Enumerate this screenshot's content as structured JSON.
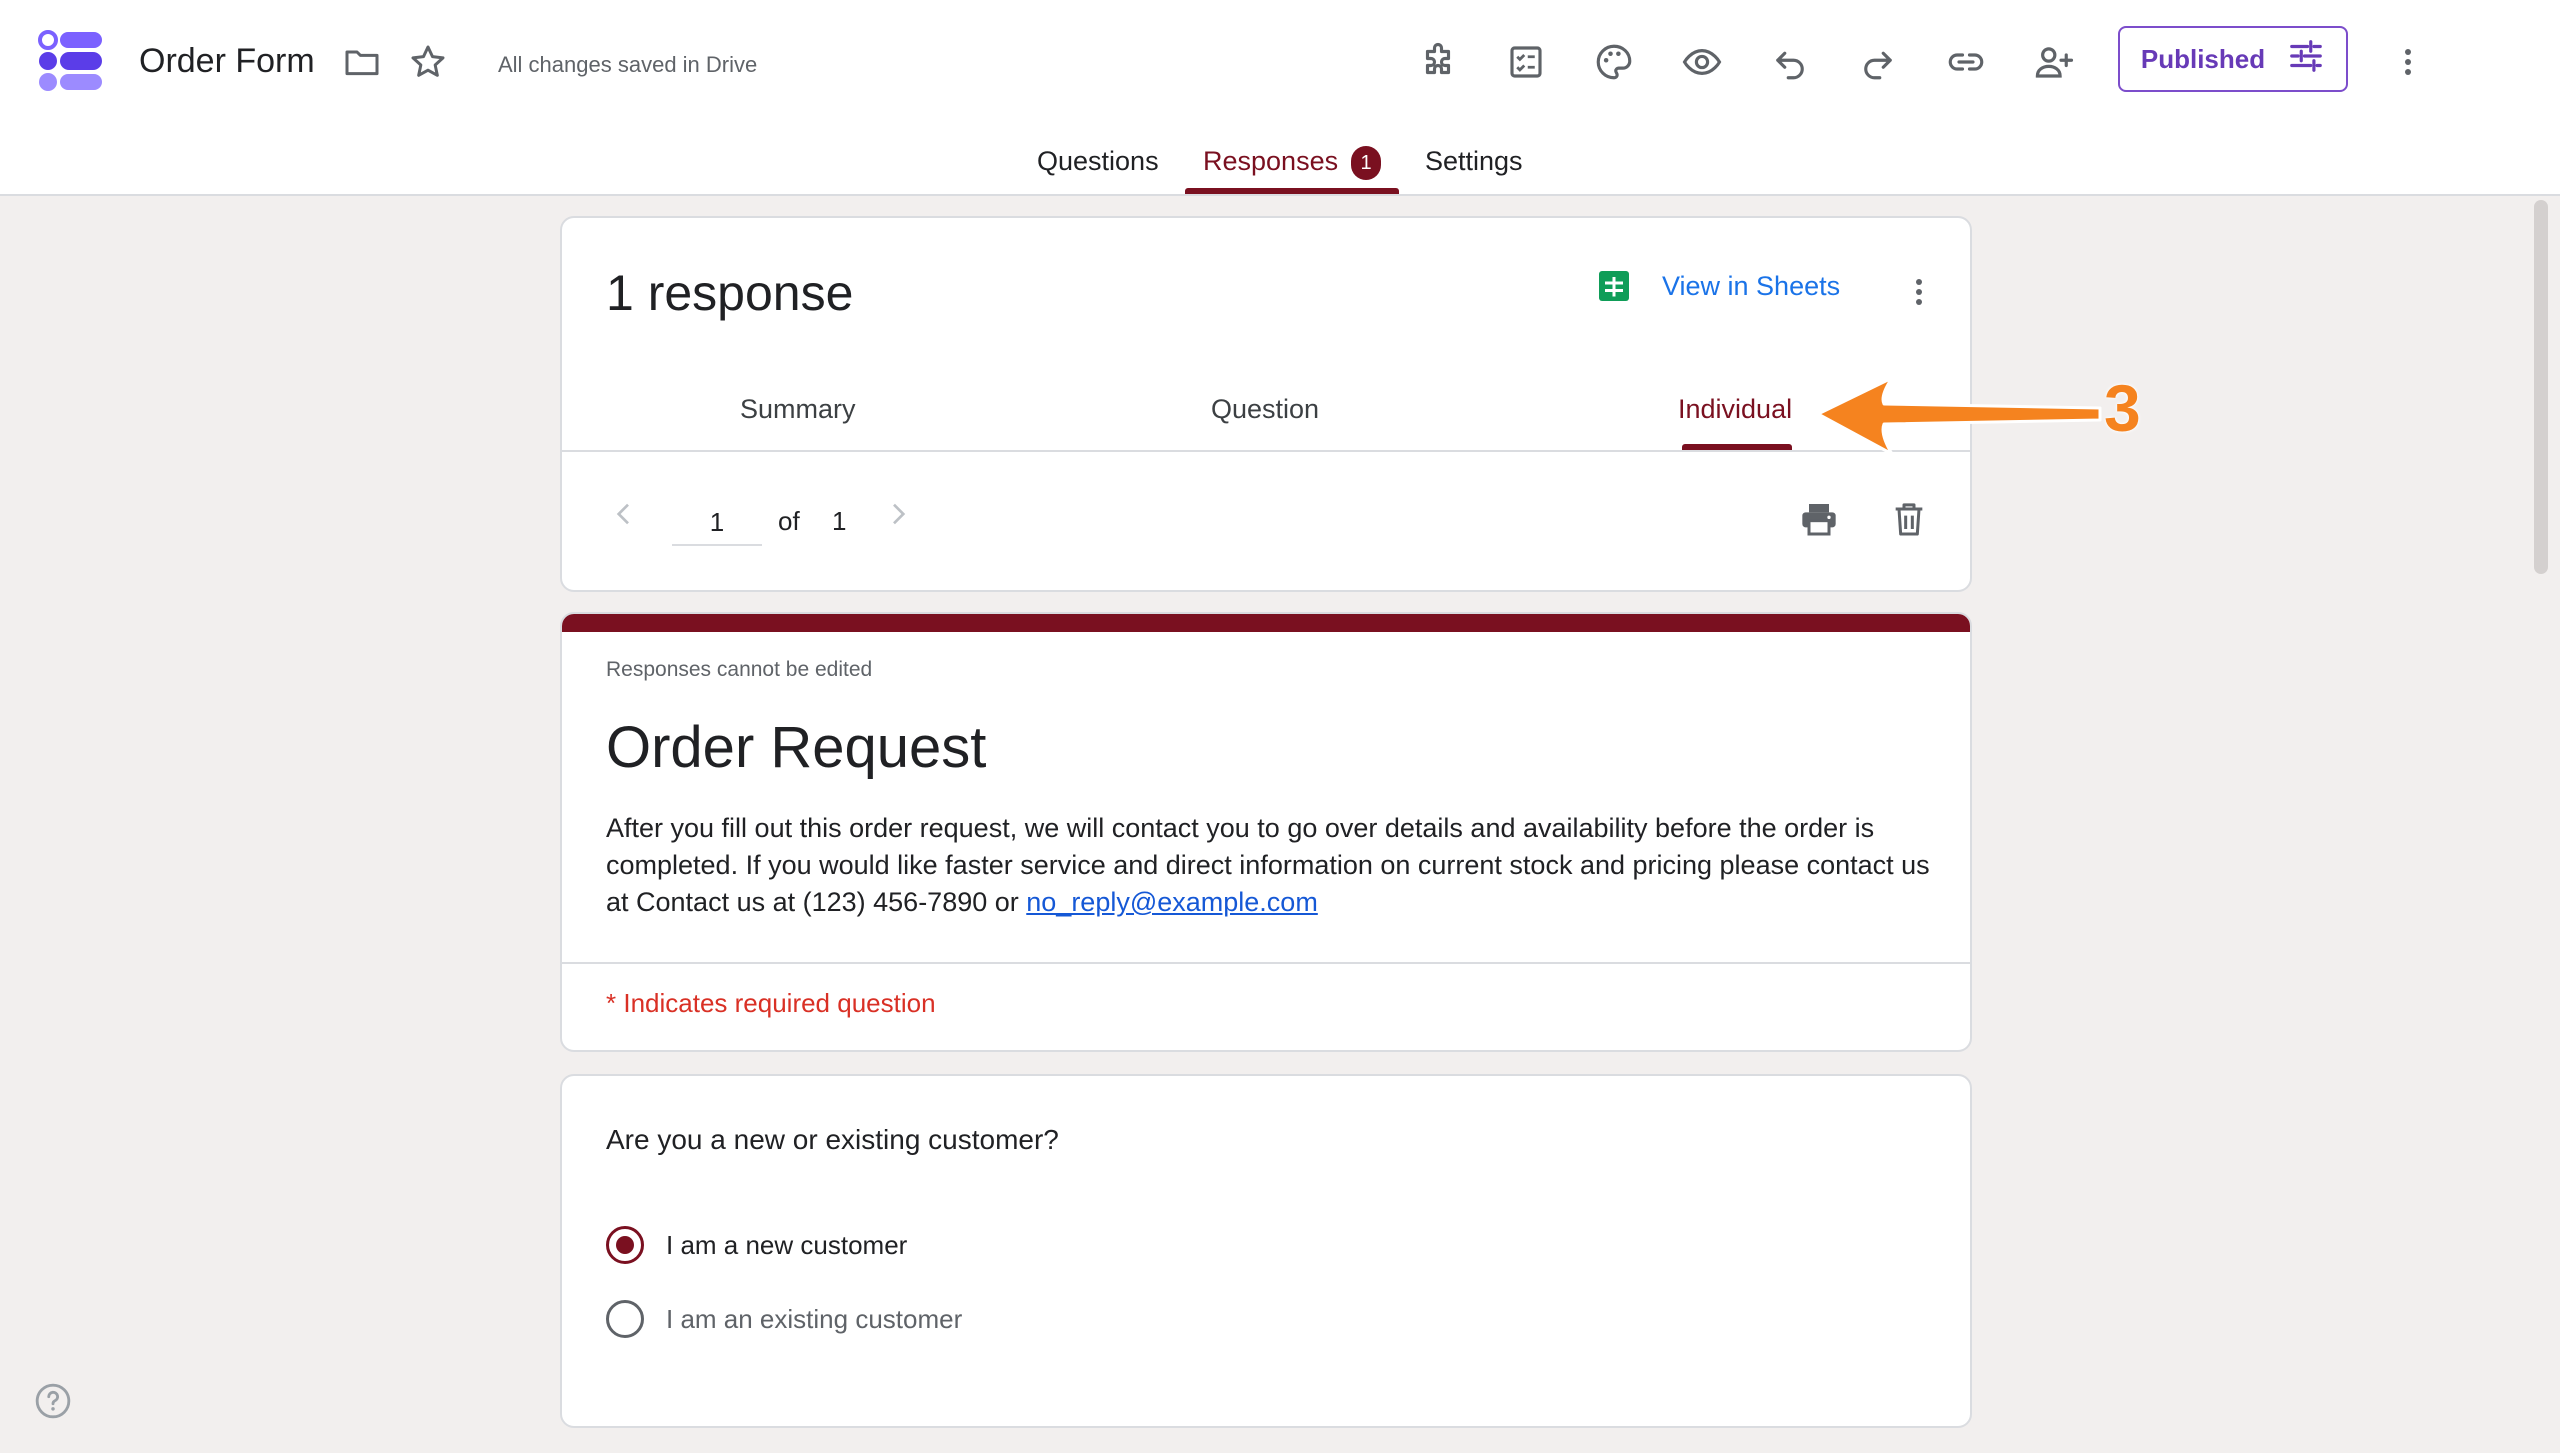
{
  "app": {
    "title": "Order Form",
    "saved_status": "All changes saved in Drive",
    "publish_label": "Published"
  },
  "main_tabs": [
    {
      "label": "Questions"
    },
    {
      "label": "Responses",
      "badge": "1"
    },
    {
      "label": "Settings"
    }
  ],
  "responses": {
    "count_label": "1 response",
    "view_sheets_label": "View in Sheets",
    "subtabs": [
      {
        "label": "Summary"
      },
      {
        "label": "Question"
      },
      {
        "label": "Individual"
      }
    ],
    "pager": {
      "current": "1",
      "of_label": "of",
      "total": "1"
    }
  },
  "form": {
    "notice": "Responses cannot be edited",
    "title": "Order Request",
    "description": "After you fill out this order request, we will contact you to go over details and availability before the order is completed. If you would like faster service and direct information on current stock and pricing please contact us at Contact us at (123) 456-7890 or ",
    "email_link": "no_reply@example.com",
    "required_note": "* Indicates required question"
  },
  "question1": {
    "text": "Are you a new or existing customer?",
    "options": [
      {
        "label": "I am a new customer",
        "selected": true
      },
      {
        "label": "I am an existing customer",
        "selected": false
      }
    ]
  },
  "annotation": {
    "number": "3",
    "color": "#f5831f"
  },
  "colors": {
    "accent": "#7a1020",
    "link": "#1a73e8",
    "publish": "#673ab7",
    "required": "#d93025"
  },
  "icons": [
    "forms-logo-icon",
    "folder-icon",
    "star-icon",
    "addon-icon",
    "quiz-icon",
    "palette-icon",
    "preview-eye-icon",
    "undo-icon",
    "redo-icon",
    "link-icon",
    "add-collaborator-icon",
    "tune-icon",
    "more-vert-icon",
    "sheets-icon",
    "chevron-left-icon",
    "chevron-right-icon",
    "print-icon",
    "trash-icon",
    "help-icon"
  ]
}
